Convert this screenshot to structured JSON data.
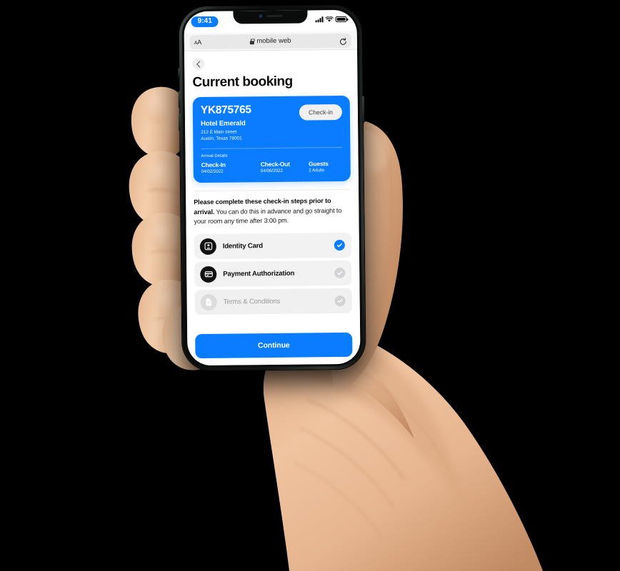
{
  "status_bar": {
    "time": "9:41",
    "signal_icon": "cellular-signal-icon",
    "wifi_icon": "wifi-icon",
    "battery_icon": "battery-full-icon"
  },
  "browser_bar": {
    "text_size_label": "AA",
    "lock_icon": "lock-icon",
    "url_text": "mobile web",
    "reload_icon": "reload-icon"
  },
  "nav": {
    "back_icon": "chevron-left-icon"
  },
  "page": {
    "title": "Current booking"
  },
  "booking_card": {
    "reference": "YK875765",
    "hotel_name": "Hotel Emerald",
    "address_line1": "212 E Main street",
    "address_line2": "Austin, Texas 78001",
    "checkin_button_label": "Check-in",
    "arrival_label": "Arrival Details",
    "arrival_details": [
      {
        "heading": "Check-In",
        "value": "04/02/2022"
      },
      {
        "heading": "Check-Out",
        "value": "04/06/2022"
      },
      {
        "heading": "Guests",
        "value": "2 Adults"
      }
    ],
    "accent_color": "#0a7cff"
  },
  "instructions": {
    "bold_part": "Please complete these check-in steps prior to arrival.",
    "rest_part": " You can do this in advance and go straight to your room any time after 3:00 pm."
  },
  "steps": [
    {
      "label": "Identity Card",
      "icon": "id-card-icon",
      "icon_state": "active",
      "check_state": "completed",
      "check_icon": "check-icon"
    },
    {
      "label": "Payment Authorization",
      "icon": "credit-card-icon",
      "icon_state": "active",
      "check_state": "pending",
      "check_icon": "check-icon"
    },
    {
      "label": "Terms & Conditions",
      "icon": "document-icon",
      "icon_state": "disabled",
      "check_state": "pending",
      "check_icon": "check-icon"
    }
  ],
  "footer": {
    "continue_label": "Continue"
  }
}
